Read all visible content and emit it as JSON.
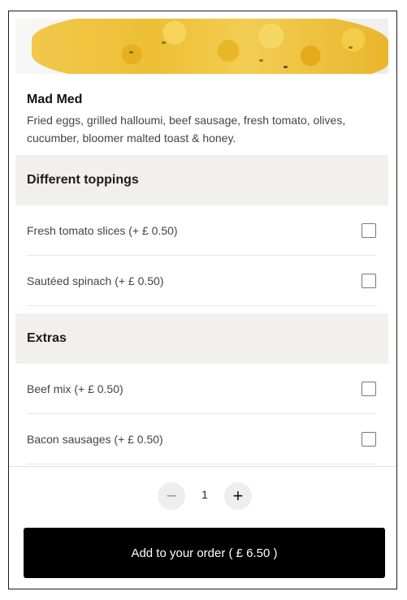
{
  "item": {
    "title": "Mad Med",
    "description": "Fried eggs, grilled halloumi, beef sausage, fresh tomato, olives, cucumber, bloomer malted toast & honey."
  },
  "sections": [
    {
      "header": "Different toppings",
      "options": [
        {
          "label": "Fresh tomato slices (+ £ 0.50)",
          "checked": false
        },
        {
          "label": "Sautéed spinach (+ £ 0.50)",
          "checked": false
        }
      ]
    },
    {
      "header": "Extras",
      "options": [
        {
          "label": "Beef mix (+ £ 0.50)",
          "checked": false
        },
        {
          "label": "Bacon sausages (+ £ 0.50)",
          "checked": false
        }
      ]
    }
  ],
  "quantity": {
    "minus_symbol": "−",
    "value": "1",
    "plus_symbol": "+"
  },
  "add_button": {
    "label": "Add to your order ( £ 6.50 )"
  },
  "colors": {
    "section_bg": "#f1f0ee",
    "button_bg": "#000000",
    "button_text": "#ffffff"
  },
  "icons": {
    "minus": "minus-icon",
    "plus": "plus-icon",
    "checkbox": "checkbox-icon"
  }
}
